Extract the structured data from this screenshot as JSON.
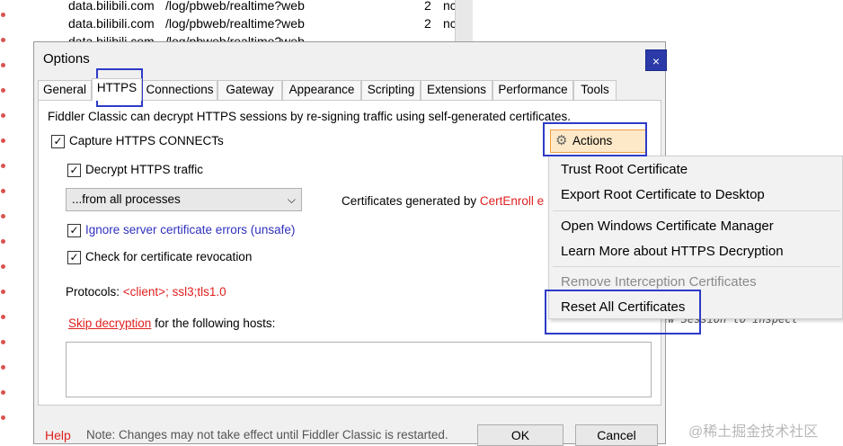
{
  "background": {
    "rows": [
      {
        "host": "data.bilibili.com",
        "url": "/log/pbweb/realtime?web",
        "num": "2",
        "extra": "nc"
      },
      {
        "host": "data.bilibili.com",
        "url": "/log/pbweb/realtime?web",
        "num": "2",
        "extra": "nc"
      },
      {
        "host": "data.bilibili.com",
        "url": "/log/pbweb/realtime?web",
        "num": "",
        "extra": ""
      }
    ],
    "hint_text": "ew Session to inspect"
  },
  "dialog": {
    "title": "Options",
    "close_label": "×",
    "tabs": [
      {
        "label": "General"
      },
      {
        "label": "HTTPS",
        "active": true
      },
      {
        "label": "Connections"
      },
      {
        "label": "Gateway"
      },
      {
        "label": "Appearance"
      },
      {
        "label": "Scripting"
      },
      {
        "label": "Extensions"
      },
      {
        "label": "Performance"
      },
      {
        "label": "Tools"
      }
    ],
    "https": {
      "description": "Fiddler Classic can decrypt HTTPS sessions by re-signing traffic using self-generated certificates.",
      "capture_label": "Capture HTTPS CONNECTs",
      "capture_checked": true,
      "decrypt_label": "Decrypt HTTPS traffic",
      "decrypt_checked": true,
      "process_select": "...from all processes",
      "cert_gen_prefix": "Certificates generated by ",
      "cert_gen_engine": "CertEnroll e",
      "ignore_label": "Ignore server certificate errors (unsafe)",
      "ignore_checked": true,
      "revocation_label": "Check for certificate revocation",
      "revocation_checked": true,
      "protocols_label": "Protocols: ",
      "protocols_value": "<client>; ssl3;tls1.0",
      "skip_link": "Skip decryption",
      "skip_suffix": " for the following hosts:",
      "hosts_value": "",
      "actions_label": "Actions"
    },
    "footer": {
      "help": "Help",
      "note": "Note: Changes may not take effect until Fiddler Classic is restarted.",
      "ok": "OK",
      "cancel": "Cancel"
    }
  },
  "actions_menu": {
    "items": [
      {
        "label": "Trust Root Certificate"
      },
      {
        "label": "Export Root Certificate to Desktop"
      },
      {
        "label": "Open Windows Certificate Manager"
      },
      {
        "label": "Learn More about HTTPS Decryption"
      },
      {
        "label": "Remove Interception Certificates",
        "disabled": true
      },
      {
        "label": "Reset All Certificates"
      }
    ]
  },
  "watermark": "@稀土掘金技术社区",
  "colors": {
    "accent_outline": "#2d3bc8",
    "link_red": "#e02020",
    "title_close_bg": "#2b3aa8"
  }
}
